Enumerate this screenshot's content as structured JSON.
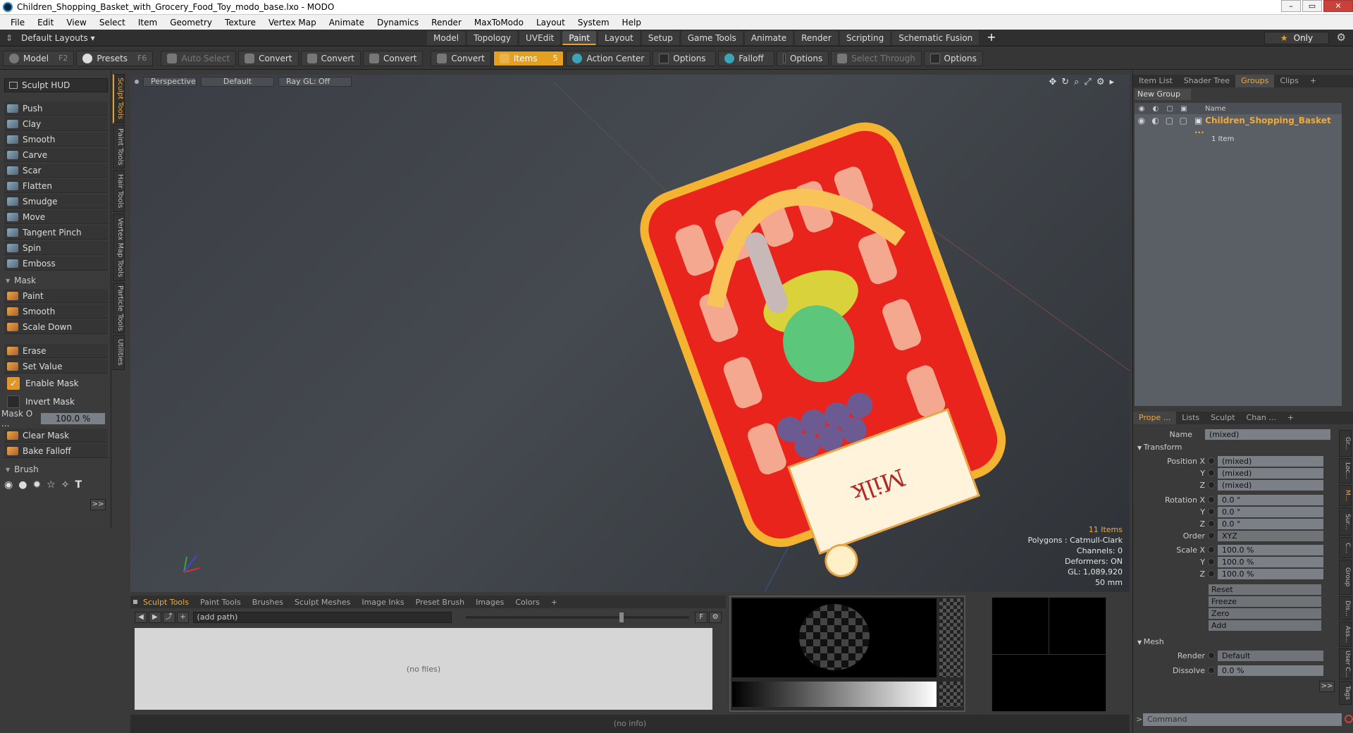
{
  "window": {
    "title": "Children_Shopping_Basket_with_Grocery_Food_Toy_modo_base.lxo - MODO",
    "min": "–",
    "max": "▭",
    "close": "✕"
  },
  "menu": [
    "File",
    "Edit",
    "View",
    "Select",
    "Item",
    "Geometry",
    "Texture",
    "Vertex Map",
    "Animate",
    "Dynamics",
    "Render",
    "MaxToModo",
    "Layout",
    "System",
    "Help"
  ],
  "layoutbar": {
    "layouts": "Default Layouts ▾",
    "tabs": [
      "Model",
      "Topology",
      "UVEdit",
      "Paint",
      "Layout",
      "Setup",
      "Game Tools",
      "Animate",
      "Render",
      "Scripting",
      "Schematic Fusion"
    ],
    "active_tab": "Paint",
    "only": "Only"
  },
  "toolbar": {
    "model": "Model",
    "model_key": "F2",
    "presets": "Presets",
    "presets_key": "F6",
    "auto_select": "Auto Select",
    "convert": "Convert",
    "items": "Items",
    "action_center": "Action Center",
    "options": "Options",
    "falloff": "Falloff",
    "select_through": "Select Through"
  },
  "left": {
    "hud": "Sculpt HUD",
    "tools": [
      "Push",
      "Clay",
      "Smooth",
      "Carve",
      "Scar",
      "Flatten",
      "Smudge",
      "Move",
      "Tangent Pinch",
      "Spin",
      "Emboss"
    ],
    "mask_header": "Mask",
    "mask_tools": [
      "Paint",
      "Smooth",
      "Scale Down"
    ],
    "erase": "Erase",
    "set_value": "Set Value",
    "enable_mask": "Enable Mask",
    "invert_mask": "Invert Mask",
    "mask_opacity_label": "Mask O ...",
    "mask_opacity": "100.0 %",
    "clear_mask": "Clear Mask",
    "bake_falloff": "Bake Falloff",
    "brush_header": "Brush",
    "more": ">>"
  },
  "vtabs": [
    "Sculpt Tools",
    "Paint Tools",
    "Hair Tools",
    "Vertex Map Tools",
    "Particle Tools",
    "Utilities"
  ],
  "viewport": {
    "view": "Perspective",
    "shading": "Default",
    "raygl": "Ray GL: Off",
    "items": "11 Items",
    "polygons": "Polygons : Catmull-Clark",
    "channels": "Channels: 0",
    "deformers": "Deformers: ON",
    "gl": "GL: 1,089,920",
    "units": "50 mm",
    "label": "Milk"
  },
  "bottom": {
    "tabs": [
      "Sculpt Tools",
      "Paint Tools",
      "Brushes",
      "Sculpt Meshes",
      "Image Inks",
      "Preset Brush",
      "Images",
      "Colors"
    ],
    "path": "(add path)",
    "no_files": "(no files)",
    "plus": "+"
  },
  "status": "(no info)",
  "right": {
    "tabs": [
      "Item List",
      "Shader Tree",
      "Groups",
      "Clips"
    ],
    "active_tab": "Groups",
    "new_group": "New Group",
    "col_name": "Name",
    "group_name": "Children_Shopping_Basket ...",
    "group_count": "1 Item",
    "ptabs": [
      "Prope ...",
      "Lists",
      "Sculpt",
      "Chan ..."
    ],
    "name_label": "Name",
    "name_value": "(mixed)",
    "transform": "Transform",
    "pos_x": "Position X",
    "pos_y": "Y",
    "pos_z": "Z",
    "mixed": "(mixed)",
    "rot_x": "Rotation X",
    "rot": "0.0 °",
    "order_label": "Order",
    "order": "XYZ",
    "scale_x": "Scale X",
    "scale": "100.0 %",
    "reset": "Reset",
    "freeze": "Freeze",
    "zero": "Zero",
    "add": "Add",
    "mesh": "Mesh",
    "render_label": "Render",
    "render": "Default",
    "dissolve_label": "Dissolve",
    "dissolve": "0.0 %",
    "more": ">>",
    "command": "Command",
    "rvtabs": [
      "Gr...",
      "Loc...",
      "M...",
      "Sur...",
      "C...",
      "Group",
      "Dis...",
      "Ass...",
      "User C...",
      "Tags"
    ]
  },
  "colors": {
    "accent": "#e3a22a"
  }
}
